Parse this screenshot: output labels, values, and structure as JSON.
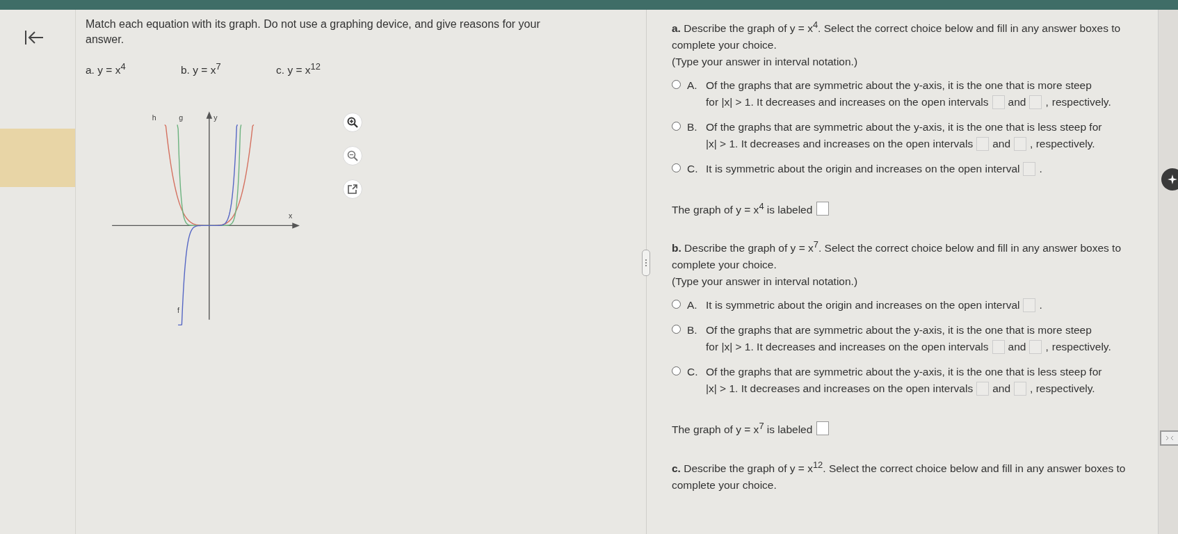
{
  "problem": {
    "prompt": "Match each equation with its graph. Do not use a graphing device, and give reasons for your answer.",
    "equations": [
      {
        "letter": "a.",
        "text": "y = x$^{4}$"
      },
      {
        "letter": "b.",
        "text": "y = x$^{7}$"
      },
      {
        "letter": "c.",
        "text": "y = x$^{12}$"
      }
    ],
    "graph": {
      "curve_labels": [
        "h",
        "g",
        "f"
      ],
      "y_axis_label": "y",
      "x_axis_label": "x"
    }
  },
  "parts": [
    {
      "letter": "a.",
      "question": "Describe the graph of y = x$^{4}$. Select the correct choice below and fill in any answer boxes to complete your choice.",
      "note": "(Type your answer in interval notation.)",
      "choices": [
        {
          "letter": "A.",
          "selected": false,
          "segments": [
            {
              "kind": "text",
              "text": "Of the graphs that are symmetric about the y-axis, it is the one that is more steep"
            },
            {
              "kind": "text",
              "text": "for |x| > 1. It decreases and increases on the open intervals"
            },
            {
              "kind": "box"
            },
            {
              "kind": "text",
              "text": "and"
            },
            {
              "kind": "box"
            },
            {
              "kind": "text",
              "text": ","
            },
            {
              "kind": "text",
              "text": "respectively."
            }
          ]
        },
        {
          "letter": "B.",
          "selected": false,
          "segments": [
            {
              "kind": "text",
              "text": "Of the graphs that are symmetric about the y-axis, it is the one that is less steep for"
            },
            {
              "kind": "text",
              "text": "|x| > 1. It decreases and increases on the open intervals"
            },
            {
              "kind": "box"
            },
            {
              "kind": "text",
              "text": "and"
            },
            {
              "kind": "box"
            },
            {
              "kind": "text",
              "text": ", respectively."
            }
          ]
        },
        {
          "letter": "C.",
          "selected": false,
          "segments": [
            {
              "kind": "text",
              "text": "It is symmetric about the origin and increases on the open interval"
            },
            {
              "kind": "box"
            },
            {
              "kind": "text",
              "text": "."
            }
          ]
        }
      ],
      "labeled": "The graph of y = x$^{4}$ is labeled"
    },
    {
      "letter": "b.",
      "question": "Describe the graph of y = x$^{7}$. Select the correct choice below and fill in any answer boxes to complete your choice.",
      "note": "(Type your answer in interval notation.)",
      "choices": [
        {
          "letter": "A.",
          "selected": false,
          "segments": [
            {
              "kind": "text",
              "text": "It is symmetric about the origin and increases on the open interval"
            },
            {
              "kind": "box"
            },
            {
              "kind": "text",
              "text": "."
            }
          ]
        },
        {
          "letter": "B.",
          "selected": false,
          "segments": [
            {
              "kind": "text",
              "text": "Of the graphs that are symmetric about the y-axis, it is the one that is more steep"
            },
            {
              "kind": "text",
              "text": "for |x| > 1. It decreases and increases on the open intervals"
            },
            {
              "kind": "box"
            },
            {
              "kind": "text",
              "text": "and"
            },
            {
              "kind": "box"
            },
            {
              "kind": "text",
              "text": ","
            },
            {
              "kind": "text",
              "text": "respectively."
            }
          ]
        },
        {
          "letter": "C.",
          "selected": false,
          "segments": [
            {
              "kind": "text",
              "text": "Of the graphs that are symmetric about the y-axis, it is the one that is less steep for"
            },
            {
              "kind": "text",
              "text": "|x| > 1. It decreases and increases on the open intervals"
            },
            {
              "kind": "box"
            },
            {
              "kind": "text",
              "text": "and"
            },
            {
              "kind": "box"
            },
            {
              "kind": "text",
              "text": ", respectively."
            }
          ]
        }
      ],
      "labeled": "The graph of y = x$^{7}$ is labeled"
    },
    {
      "letter": "c.",
      "question": "Describe the graph of y = x$^{12}$. Select the correct choice below and fill in any answer boxes to complete your choice."
    }
  ]
}
